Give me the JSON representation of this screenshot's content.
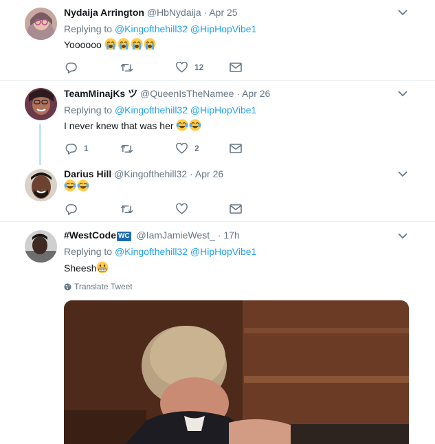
{
  "tweets": [
    {
      "name": "Nydaija Arrington",
      "handle": "@HbNydaija",
      "time": "Apr 25",
      "replying_to_label": "Replying to",
      "mention1": "@Kingofthehill32",
      "mention2": "@HipHopVibe1",
      "text": "Yoooooo",
      "emoji": [
        "loudly-crying-face",
        "loudly-crying-face",
        "loudly-crying-face",
        "loudly-crying-face"
      ],
      "reply_count": "",
      "retweet_count": "",
      "like_count": "12"
    },
    {
      "name": "TeamMinajKs ツ",
      "handle": "@QueenIsTheNamee",
      "time": "Apr 26",
      "replying_to_label": "Replying to",
      "mention1": "@Kingofthehill32",
      "mention2": "@HipHopVibe1",
      "text": "I never knew that was her",
      "emoji": [
        "tears-of-joy",
        "tears-of-joy"
      ],
      "reply_count": "1",
      "retweet_count": "",
      "like_count": "2"
    },
    {
      "name": "Darius Hill",
      "handle": "@Kingofthehill32",
      "time": "Apr 26",
      "text": "",
      "emoji": [
        "tears-of-joy",
        "tears-of-joy"
      ],
      "reply_count": "",
      "retweet_count": "",
      "like_count": ""
    },
    {
      "name": "#WestCode",
      "badge": "WC",
      "handle": "@IamJamieWest_",
      "time": "17h",
      "replying_to_label": "Replying to",
      "mention1": "@Kingofthehill32",
      "mention2": "@HipHopVibe1",
      "text": "Sheesh",
      "emoji": [
        "grimacing-face"
      ],
      "translate_label": "Translate Tweet"
    }
  ],
  "separator": "·",
  "colors": {
    "link": "#1da1f2",
    "muted": "#657786",
    "thread_line": "#c4e4fb"
  }
}
